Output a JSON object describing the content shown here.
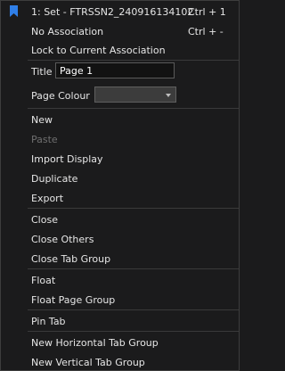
{
  "association": {
    "current_label": "1: Set - FTRSSN2_240916134102",
    "current_shortcut": "Ctrl + 1",
    "no_association_label": "No Association",
    "no_association_shortcut": "Ctrl + -",
    "lock_label": "Lock to Current Association",
    "icon": "bookmark-icon",
    "icon_color": "#2f7fe8"
  },
  "properties": {
    "title_label": "Title",
    "title_value": "Page 1",
    "page_colour_label": "Page Colour",
    "page_colour_value": ""
  },
  "items": {
    "new": "New",
    "paste": "Paste",
    "import_display": "Import Display",
    "duplicate": "Duplicate",
    "export": "Export",
    "close": "Close",
    "close_others": "Close Others",
    "close_tab_group": "Close Tab Group",
    "float": "Float",
    "float_page_group": "Float Page Group",
    "pin_tab": "Pin Tab",
    "new_horizontal_tab_group": "New Horizontal Tab Group",
    "new_vertical_tab_group": "New Vertical Tab Group"
  },
  "colors": {
    "menu_background": "#1b1b1c",
    "text": "#e6e6e6",
    "disabled_text": "#6f6f6f",
    "separator": "#3a3a3a"
  }
}
